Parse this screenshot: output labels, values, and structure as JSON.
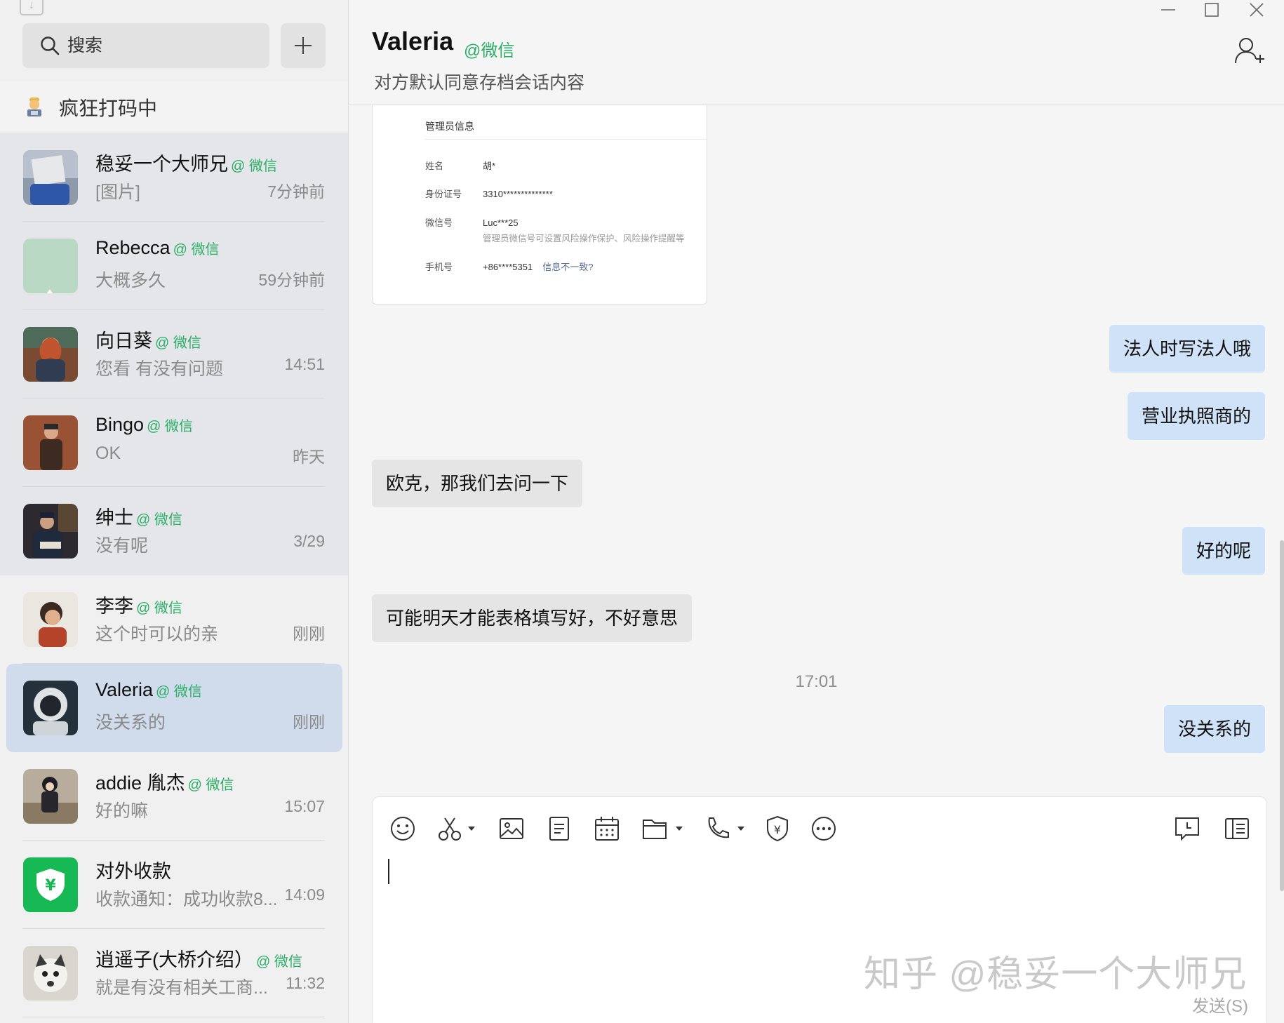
{
  "sidebar": {
    "search_placeholder": "搜索",
    "add_label": "+",
    "status_text": "疯狂打码中",
    "chats": [
      {
        "name": "稳妥一个大师兄",
        "tag": "@ 微信",
        "preview": "[图片]",
        "time": "7分钟前"
      },
      {
        "name": "Rebecca",
        "tag": "@ 微信",
        "preview": "大概多久",
        "time": "59分钟前"
      },
      {
        "name": "向日葵",
        "tag": "@ 微信",
        "preview": "您看 有没有问题",
        "time": "14:51"
      },
      {
        "name": "Bingo",
        "tag": "@ 微信",
        "preview": "OK",
        "time": "昨天"
      },
      {
        "name": "绅士",
        "tag": "@ 微信",
        "preview": "没有呢",
        "time": "3/29"
      },
      {
        "name": "李李",
        "tag": "@ 微信",
        "preview": "这个时可以的亲",
        "time": "刚刚"
      },
      {
        "name": "Valeria",
        "tag": "@ 微信",
        "preview": "没关系的",
        "time": "刚刚"
      },
      {
        "name": "addie 胤杰",
        "tag": "@ 微信",
        "preview": "好的嘛",
        "time": "15:07"
      },
      {
        "name": "对外收款",
        "tag": "",
        "preview": "收款通知：成功收款8...",
        "time": "14:09"
      },
      {
        "name": "逍遥子(大桥介绍）",
        "tag": "@ 微信",
        "preview": "就是有没有相关工商...",
        "time": "11:32"
      }
    ]
  },
  "header": {
    "title": "Valeria",
    "title_tag": "@微信",
    "subtitle": "对方默认同意存档会话内容"
  },
  "card": {
    "title": "管理员信息",
    "rows": [
      {
        "key": "姓名",
        "value": "胡*"
      },
      {
        "key": "身份证号",
        "value": "3310**************"
      },
      {
        "key": "微信号",
        "value": "Luc***25"
      },
      {
        "key": "手机号",
        "value": "+86****5351",
        "link": "信息不一致?"
      }
    ],
    "note": "管理员微信号可设置风险操作保护、风险操作提醒等"
  },
  "messages": [
    {
      "dir": "out",
      "text": "法人时写法人哦"
    },
    {
      "dir": "out",
      "text": "营业执照商的"
    },
    {
      "dir": "in",
      "text": "欧克，那我们去问一下"
    },
    {
      "dir": "out",
      "text": "好的呢"
    },
    {
      "dir": "in",
      "text": "可能明天才能表格填写好，不好意思"
    },
    {
      "dir": "out",
      "text": "没关系的"
    }
  ],
  "timestamp": "17:01",
  "composer": {
    "watermark": "知乎 @稳妥一个大师兄",
    "send_label": "发送(S)"
  },
  "colors": {
    "accent_green": "#2aae67",
    "bubble_out": "#cfe2f7",
    "bubble_in": "#e5e5e5",
    "selected_row": "#d0dcec"
  },
  "icons": [
    "search-icon",
    "plus-icon",
    "emoji-icon",
    "scissors-icon",
    "image-icon",
    "document-icon",
    "calendar-icon",
    "folder-icon",
    "phone-icon",
    "payment-icon",
    "more-icon",
    "history-icon",
    "sidebar-toggle-icon",
    "add-contact-icon",
    "minimize-icon",
    "maximize-icon",
    "close-icon"
  ]
}
